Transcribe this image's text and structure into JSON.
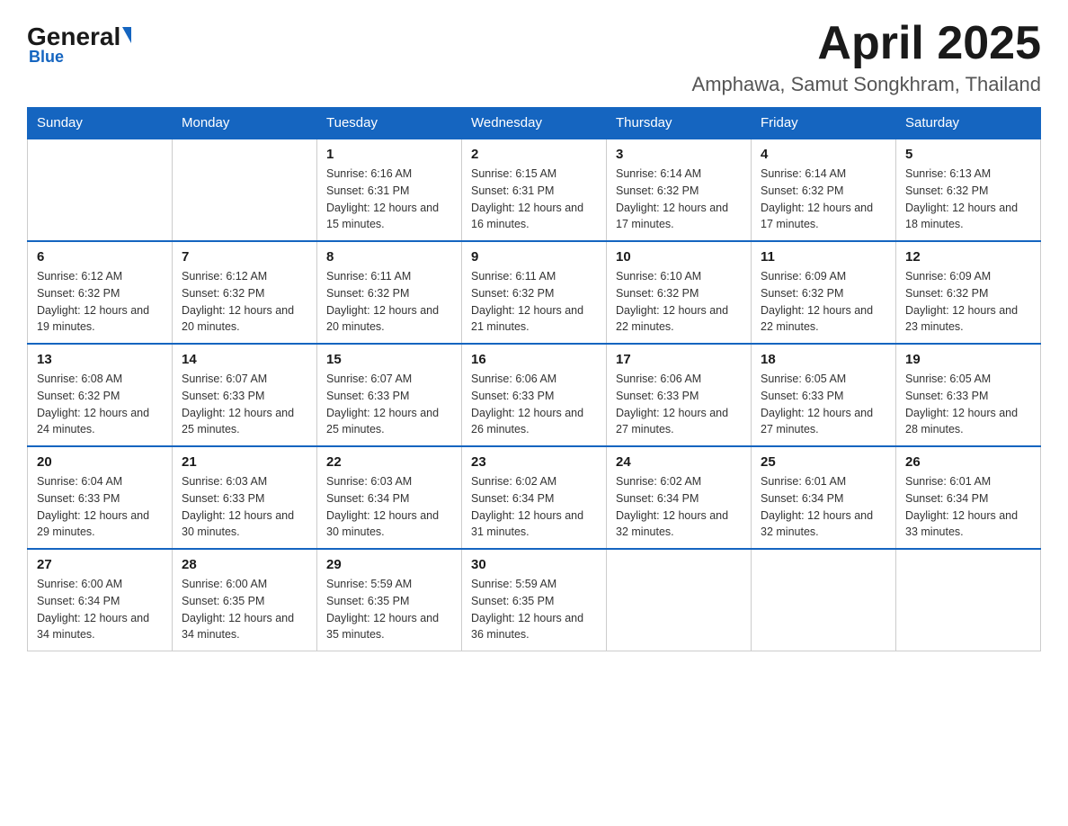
{
  "logo": {
    "general": "General",
    "blue": "Blue",
    "subtitle": "Blue"
  },
  "header": {
    "month_year": "April 2025",
    "location": "Amphawa, Samut Songkhram, Thailand"
  },
  "weekdays": [
    "Sunday",
    "Monday",
    "Tuesday",
    "Wednesday",
    "Thursday",
    "Friday",
    "Saturday"
  ],
  "weeks": [
    [
      {
        "day": "",
        "sunrise": "",
        "sunset": "",
        "daylight": ""
      },
      {
        "day": "",
        "sunrise": "",
        "sunset": "",
        "daylight": ""
      },
      {
        "day": "1",
        "sunrise": "Sunrise: 6:16 AM",
        "sunset": "Sunset: 6:31 PM",
        "daylight": "Daylight: 12 hours and 15 minutes."
      },
      {
        "day": "2",
        "sunrise": "Sunrise: 6:15 AM",
        "sunset": "Sunset: 6:31 PM",
        "daylight": "Daylight: 12 hours and 16 minutes."
      },
      {
        "day": "3",
        "sunrise": "Sunrise: 6:14 AM",
        "sunset": "Sunset: 6:32 PM",
        "daylight": "Daylight: 12 hours and 17 minutes."
      },
      {
        "day": "4",
        "sunrise": "Sunrise: 6:14 AM",
        "sunset": "Sunset: 6:32 PM",
        "daylight": "Daylight: 12 hours and 17 minutes."
      },
      {
        "day": "5",
        "sunrise": "Sunrise: 6:13 AM",
        "sunset": "Sunset: 6:32 PM",
        "daylight": "Daylight: 12 hours and 18 minutes."
      }
    ],
    [
      {
        "day": "6",
        "sunrise": "Sunrise: 6:12 AM",
        "sunset": "Sunset: 6:32 PM",
        "daylight": "Daylight: 12 hours and 19 minutes."
      },
      {
        "day": "7",
        "sunrise": "Sunrise: 6:12 AM",
        "sunset": "Sunset: 6:32 PM",
        "daylight": "Daylight: 12 hours and 20 minutes."
      },
      {
        "day": "8",
        "sunrise": "Sunrise: 6:11 AM",
        "sunset": "Sunset: 6:32 PM",
        "daylight": "Daylight: 12 hours and 20 minutes."
      },
      {
        "day": "9",
        "sunrise": "Sunrise: 6:11 AM",
        "sunset": "Sunset: 6:32 PM",
        "daylight": "Daylight: 12 hours and 21 minutes."
      },
      {
        "day": "10",
        "sunrise": "Sunrise: 6:10 AM",
        "sunset": "Sunset: 6:32 PM",
        "daylight": "Daylight: 12 hours and 22 minutes."
      },
      {
        "day": "11",
        "sunrise": "Sunrise: 6:09 AM",
        "sunset": "Sunset: 6:32 PM",
        "daylight": "Daylight: 12 hours and 22 minutes."
      },
      {
        "day": "12",
        "sunrise": "Sunrise: 6:09 AM",
        "sunset": "Sunset: 6:32 PM",
        "daylight": "Daylight: 12 hours and 23 minutes."
      }
    ],
    [
      {
        "day": "13",
        "sunrise": "Sunrise: 6:08 AM",
        "sunset": "Sunset: 6:32 PM",
        "daylight": "Daylight: 12 hours and 24 minutes."
      },
      {
        "day": "14",
        "sunrise": "Sunrise: 6:07 AM",
        "sunset": "Sunset: 6:33 PM",
        "daylight": "Daylight: 12 hours and 25 minutes."
      },
      {
        "day": "15",
        "sunrise": "Sunrise: 6:07 AM",
        "sunset": "Sunset: 6:33 PM",
        "daylight": "Daylight: 12 hours and 25 minutes."
      },
      {
        "day": "16",
        "sunrise": "Sunrise: 6:06 AM",
        "sunset": "Sunset: 6:33 PM",
        "daylight": "Daylight: 12 hours and 26 minutes."
      },
      {
        "day": "17",
        "sunrise": "Sunrise: 6:06 AM",
        "sunset": "Sunset: 6:33 PM",
        "daylight": "Daylight: 12 hours and 27 minutes."
      },
      {
        "day": "18",
        "sunrise": "Sunrise: 6:05 AM",
        "sunset": "Sunset: 6:33 PM",
        "daylight": "Daylight: 12 hours and 27 minutes."
      },
      {
        "day": "19",
        "sunrise": "Sunrise: 6:05 AM",
        "sunset": "Sunset: 6:33 PM",
        "daylight": "Daylight: 12 hours and 28 minutes."
      }
    ],
    [
      {
        "day": "20",
        "sunrise": "Sunrise: 6:04 AM",
        "sunset": "Sunset: 6:33 PM",
        "daylight": "Daylight: 12 hours and 29 minutes."
      },
      {
        "day": "21",
        "sunrise": "Sunrise: 6:03 AM",
        "sunset": "Sunset: 6:33 PM",
        "daylight": "Daylight: 12 hours and 30 minutes."
      },
      {
        "day": "22",
        "sunrise": "Sunrise: 6:03 AM",
        "sunset": "Sunset: 6:34 PM",
        "daylight": "Daylight: 12 hours and 30 minutes."
      },
      {
        "day": "23",
        "sunrise": "Sunrise: 6:02 AM",
        "sunset": "Sunset: 6:34 PM",
        "daylight": "Daylight: 12 hours and 31 minutes."
      },
      {
        "day": "24",
        "sunrise": "Sunrise: 6:02 AM",
        "sunset": "Sunset: 6:34 PM",
        "daylight": "Daylight: 12 hours and 32 minutes."
      },
      {
        "day": "25",
        "sunrise": "Sunrise: 6:01 AM",
        "sunset": "Sunset: 6:34 PM",
        "daylight": "Daylight: 12 hours and 32 minutes."
      },
      {
        "day": "26",
        "sunrise": "Sunrise: 6:01 AM",
        "sunset": "Sunset: 6:34 PM",
        "daylight": "Daylight: 12 hours and 33 minutes."
      }
    ],
    [
      {
        "day": "27",
        "sunrise": "Sunrise: 6:00 AM",
        "sunset": "Sunset: 6:34 PM",
        "daylight": "Daylight: 12 hours and 34 minutes."
      },
      {
        "day": "28",
        "sunrise": "Sunrise: 6:00 AM",
        "sunset": "Sunset: 6:35 PM",
        "daylight": "Daylight: 12 hours and 34 minutes."
      },
      {
        "day": "29",
        "sunrise": "Sunrise: 5:59 AM",
        "sunset": "Sunset: 6:35 PM",
        "daylight": "Daylight: 12 hours and 35 minutes."
      },
      {
        "day": "30",
        "sunrise": "Sunrise: 5:59 AM",
        "sunset": "Sunset: 6:35 PM",
        "daylight": "Daylight: 12 hours and 36 minutes."
      },
      {
        "day": "",
        "sunrise": "",
        "sunset": "",
        "daylight": ""
      },
      {
        "day": "",
        "sunrise": "",
        "sunset": "",
        "daylight": ""
      },
      {
        "day": "",
        "sunrise": "",
        "sunset": "",
        "daylight": ""
      }
    ]
  ]
}
